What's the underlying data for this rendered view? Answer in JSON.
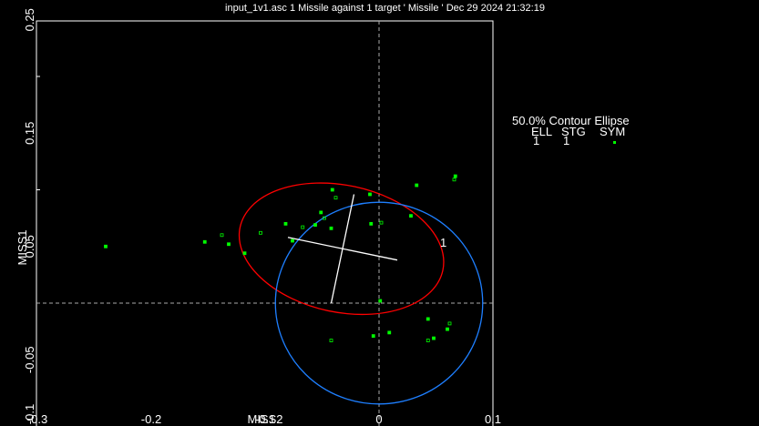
{
  "chart_data": {
    "type": "scatter",
    "title": "input_1v1.asc 1 Missile against 1 target ' Missile ' Dec 29 2024 21:32:19",
    "xlabel": "MISS2",
    "ylabel": "MISS1",
    "xlim": [
      -0.3,
      0.1
    ],
    "ylim": [
      -0.1,
      0.25
    ],
    "x_ticks": [
      "-0.3",
      "-0.2",
      "-0.1",
      "0",
      "0.1"
    ],
    "x_tick_values": [
      -0.3,
      -0.2,
      -0.1,
      0,
      0.1
    ],
    "y_ticks": [
      "0.25",
      "0.15",
      "0.05",
      "-0.05",
      "-0.1"
    ],
    "y_tick_values": [
      0.25,
      0.15,
      0.05,
      -0.05,
      -0.1
    ],
    "grid": false,
    "zero_lines": true,
    "marker_color": "#00ff00",
    "points": [
      [
        -0.24,
        0.05
      ],
      [
        -0.153,
        0.054
      ],
      [
        -0.138,
        0.06
      ],
      [
        -0.132,
        0.052
      ],
      [
        -0.118,
        0.044
      ],
      [
        -0.104,
        0.062
      ],
      [
        -0.082,
        0.07
      ],
      [
        -0.076,
        0.055
      ],
      [
        -0.067,
        0.067
      ],
      [
        -0.056,
        0.069
      ],
      [
        -0.051,
        0.08
      ],
      [
        -0.048,
        0.075
      ],
      [
        -0.042,
        0.066
      ],
      [
        -0.041,
        0.1
      ],
      [
        -0.038,
        0.093
      ],
      [
        -0.008,
        0.096
      ],
      [
        -0.007,
        0.07
      ],
      [
        0.002,
        0.071
      ],
      [
        0.028,
        0.077
      ],
      [
        0.033,
        0.104
      ],
      [
        0.066,
        0.109
      ],
      [
        0.067,
        0.112
      ],
      [
        0.043,
        -0.014
      ],
      [
        0.062,
        -0.018
      ],
      [
        0.06,
        -0.023
      ],
      [
        0.048,
        -0.031
      ],
      [
        0.043,
        -0.033
      ],
      [
        0.009,
        -0.026
      ],
      [
        -0.005,
        -0.029
      ],
      [
        -0.042,
        -0.033
      ],
      [
        0.001,
        0.002
      ]
    ],
    "ellipses": [
      {
        "name": "contour",
        "color": "#ff0000",
        "center": [
          -0.033,
          0.048
        ],
        "semi_axes": [
          0.091,
          0.056
        ],
        "angle_deg": 12
      },
      {
        "name": "reference",
        "color": "#1e7fff",
        "center": [
          0.0,
          0.0
        ],
        "semi_axes": [
          0.091,
          0.089
        ],
        "angle_deg": 0
      }
    ],
    "axes_cross": {
      "color": "#ffffff",
      "major": [
        [
          -0.08,
          0.058
        ],
        [
          0.016,
          0.038
        ]
      ],
      "minor": [
        [
          -0.022,
          0.096
        ],
        [
          -0.042,
          0.0
        ]
      ]
    },
    "ellipse_label": "1",
    "legend": {
      "title": "50.0% Contour Ellipse",
      "headers": [
        "ELL",
        "STG",
        "SYM"
      ],
      "row": [
        "1",
        "1"
      ],
      "position": "right"
    }
  }
}
